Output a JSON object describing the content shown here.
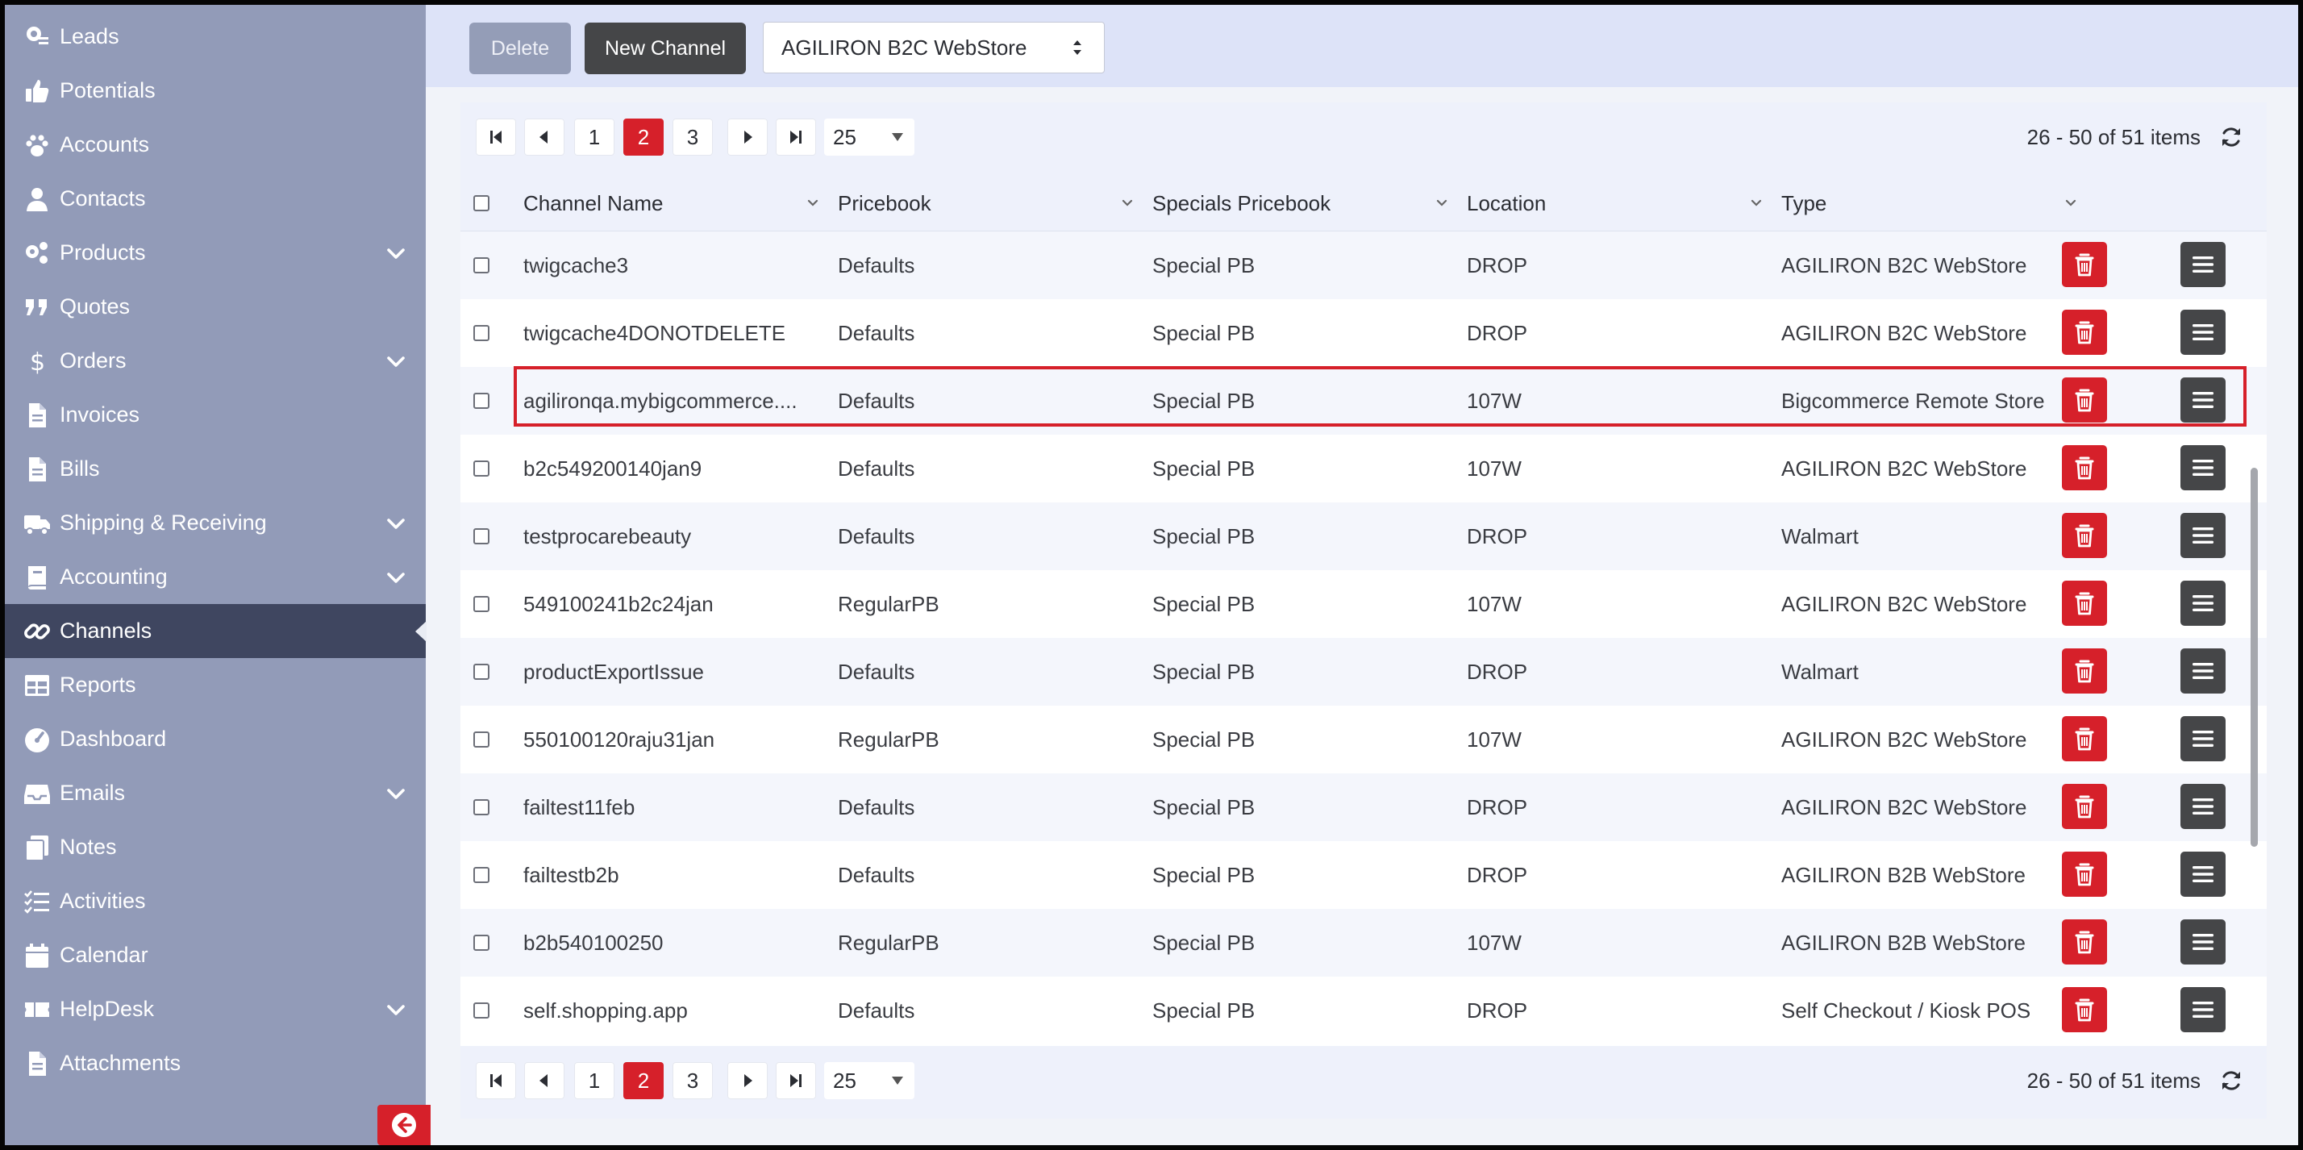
{
  "sidebar": {
    "items": [
      {
        "label": "Leads",
        "icon": "leads-icon",
        "expandable": false
      },
      {
        "label": "Potentials",
        "icon": "thumbs-up-icon",
        "expandable": false
      },
      {
        "label": "Accounts",
        "icon": "paw-icon",
        "expandable": false
      },
      {
        "label": "Contacts",
        "icon": "person-icon",
        "expandable": false
      },
      {
        "label": "Products",
        "icon": "gears-icon",
        "expandable": true
      },
      {
        "label": "Quotes",
        "icon": "quote-icon",
        "expandable": false
      },
      {
        "label": "Orders",
        "icon": "dollar-icon",
        "expandable": true
      },
      {
        "label": "Invoices",
        "icon": "file-icon",
        "expandable": false
      },
      {
        "label": "Bills",
        "icon": "file-icon",
        "expandable": false
      },
      {
        "label": "Shipping & Receiving",
        "icon": "truck-icon",
        "expandable": true
      },
      {
        "label": "Accounting",
        "icon": "book-icon",
        "expandable": true
      },
      {
        "label": "Channels",
        "icon": "link-icon",
        "expandable": false,
        "active": true
      },
      {
        "label": "Reports",
        "icon": "table-icon",
        "expandable": false
      },
      {
        "label": "Dashboard",
        "icon": "gauge-icon",
        "expandable": false
      },
      {
        "label": "Emails",
        "icon": "inbox-icon",
        "expandable": true
      },
      {
        "label": "Notes",
        "icon": "notes-icon",
        "expandable": false
      },
      {
        "label": "Activities",
        "icon": "tasks-icon",
        "expandable": false
      },
      {
        "label": "Calendar",
        "icon": "calendar-icon",
        "expandable": false
      },
      {
        "label": "HelpDesk",
        "icon": "ticket-icon",
        "expandable": true
      },
      {
        "label": "Attachments",
        "icon": "file-icon",
        "expandable": false
      }
    ]
  },
  "toolbar": {
    "delete_label": "Delete",
    "new_channel_label": "New Channel",
    "store_select_value": "AGILIRON B2C WebStore"
  },
  "pager": {
    "pages": [
      "1",
      "2",
      "3"
    ],
    "current_page": "2",
    "page_size": "25",
    "info": "26 - 50 of 51 items"
  },
  "columns": [
    "Channel Name",
    "Pricebook",
    "Specials Pricebook",
    "Location",
    "Type"
  ],
  "rows": [
    {
      "name": "twigcache3",
      "pricebook": "Defaults",
      "specials": "Special PB",
      "location": "DROP",
      "type": "AGILIRON B2C WebStore"
    },
    {
      "name": "twigcache4DONOTDELETE",
      "pricebook": "Defaults",
      "specials": "Special PB",
      "location": "DROP",
      "type": "AGILIRON B2C WebStore"
    },
    {
      "name": "agilironqa.mybigcommerce....",
      "pricebook": "Defaults",
      "specials": "Special PB",
      "location": "107W",
      "type": "Bigcommerce Remote Store",
      "highlighted": true
    },
    {
      "name": "b2c549200140jan9",
      "pricebook": "Defaults",
      "specials": "Special PB",
      "location": "107W",
      "type": "AGILIRON B2C WebStore"
    },
    {
      "name": "testprocarebeauty",
      "pricebook": "Defaults",
      "specials": "Special PB",
      "location": "DROP",
      "type": "Walmart"
    },
    {
      "name": "549100241b2c24jan",
      "pricebook": "RegularPB",
      "specials": "Special PB",
      "location": "107W",
      "type": "AGILIRON B2C WebStore"
    },
    {
      "name": "productExportIssue",
      "pricebook": "Defaults",
      "specials": "Special PB",
      "location": "DROP",
      "type": "Walmart"
    },
    {
      "name": "550100120raju31jan",
      "pricebook": "RegularPB",
      "specials": "Special PB",
      "location": "107W",
      "type": "AGILIRON B2C WebStore"
    },
    {
      "name": "failtest11feb",
      "pricebook": "Defaults",
      "specials": "Special PB",
      "location": "DROP",
      "type": "AGILIRON B2C WebStore"
    },
    {
      "name": "failtestb2b",
      "pricebook": "Defaults",
      "specials": "Special PB",
      "location": "DROP",
      "type": "AGILIRON B2B WebStore"
    },
    {
      "name": "b2b540100250",
      "pricebook": "RegularPB",
      "specials": "Special PB",
      "location": "107W",
      "type": "AGILIRON B2B WebStore"
    },
    {
      "name": "self.shopping.app",
      "pricebook": "Defaults",
      "specials": "Special PB",
      "location": "DROP",
      "type": "Self Checkout / Kiosk POS"
    }
  ],
  "colors": {
    "sidebar_bg": "#929bb8",
    "sidebar_active": "#3f4660",
    "accent_red": "#d6202a",
    "dark_button": "#454648"
  }
}
